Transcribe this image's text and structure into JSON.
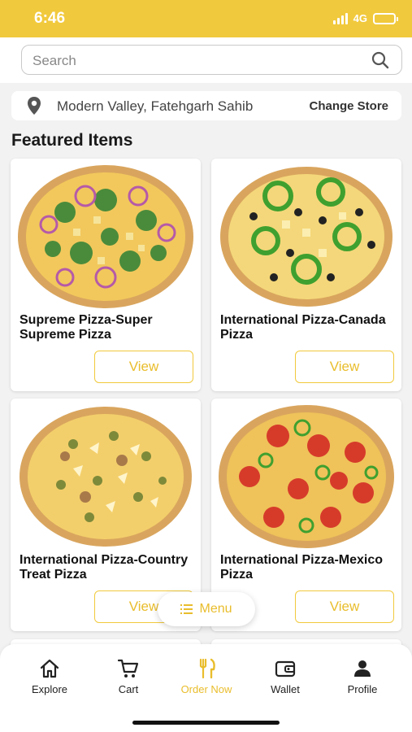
{
  "status_bar": {
    "time": "6:46",
    "network": "4G",
    "signal_icon": "signal-bars-icon",
    "battery_icon": "battery-icon"
  },
  "search": {
    "placeholder": "Search",
    "icon": "search-icon"
  },
  "location": {
    "icon": "location-pin-icon",
    "address": "Modern Valley, Fatehgarh Sahib",
    "change_label": "Change Store"
  },
  "featured": {
    "title": "Featured Items",
    "items": [
      {
        "name": "Supreme Pizza-Super Supreme Pizza",
        "view_label": "View"
      },
      {
        "name": "International Pizza-Canada Pizza",
        "view_label": "View"
      },
      {
        "name": "International Pizza-Country Treat Pizza",
        "view_label": "View"
      },
      {
        "name": "International Pizza-Mexico Pizza",
        "view_label": "View"
      }
    ]
  },
  "menu_button": {
    "label": "Menu",
    "icon": "list-icon"
  },
  "tabbar": {
    "tabs": [
      {
        "label": "Explore",
        "icon": "home-icon",
        "active": false
      },
      {
        "label": "Cart",
        "icon": "cart-icon",
        "active": false
      },
      {
        "label": "Order Now",
        "icon": "fork-knife-icon",
        "active": true
      },
      {
        "label": "Wallet",
        "icon": "wallet-icon",
        "active": false
      },
      {
        "label": "Profile",
        "icon": "person-icon",
        "active": false
      }
    ]
  },
  "colors": {
    "accent": "#f1c93c",
    "accent_text": "#e9bd2c",
    "background": "#f2f2f2"
  }
}
